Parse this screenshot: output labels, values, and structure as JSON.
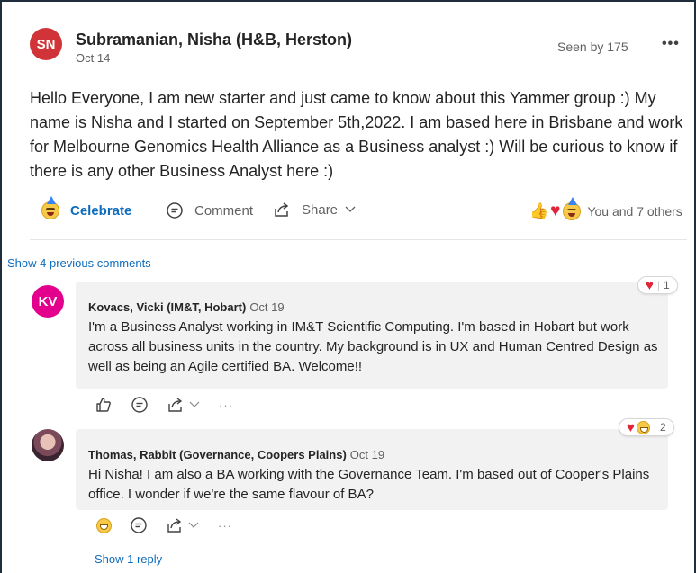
{
  "post": {
    "avatar_initials": "SN",
    "author": "Subramanian, Nisha (H&B, Herston)",
    "date": "Oct 14",
    "seen_by": "Seen by 175",
    "more": "•••",
    "body": "Hello Everyone, I am new starter and just came to know about this Yammer group :) My name is Nisha and I started on September 5th,2022. I am based here in Brisbane and work for Melbourne Genomics Health Alliance as a Business analyst :) Will be curious to know if there is any other Business Analyst here :)",
    "actions": {
      "celebrate": "Celebrate",
      "comment": "Comment",
      "share": "Share"
    },
    "reaction_summary": "You and 7 others",
    "colors": {
      "accent": "#0f6cbd",
      "avatar": "#d13438"
    }
  },
  "show_previous": "Show 4 previous comments",
  "comments": [
    {
      "avatar_initials": "KV",
      "author": "Kovacs, Vicki (IM&T, Hobart)",
      "date": "Oct 19",
      "text": "I'm a Business Analyst working in IM&T Scientific Computing. I'm based in Hobart but work across all business units in the country. My background is in UX and Human Centred Design as well as being an Agile certified BA. Welcome!!",
      "reaction_count": "1",
      "more": "···"
    },
    {
      "author": "Thomas, Rabbit (Governance, Coopers Plains)",
      "date": "Oct 19",
      "text": "Hi Nisha!  I am also a BA working with the Governance Team. I'm based out of Cooper's Plains office. I wonder if we're the same flavour of BA?",
      "reaction_count": "2",
      "more": "···"
    }
  ],
  "show_reply": "Show 1 reply"
}
